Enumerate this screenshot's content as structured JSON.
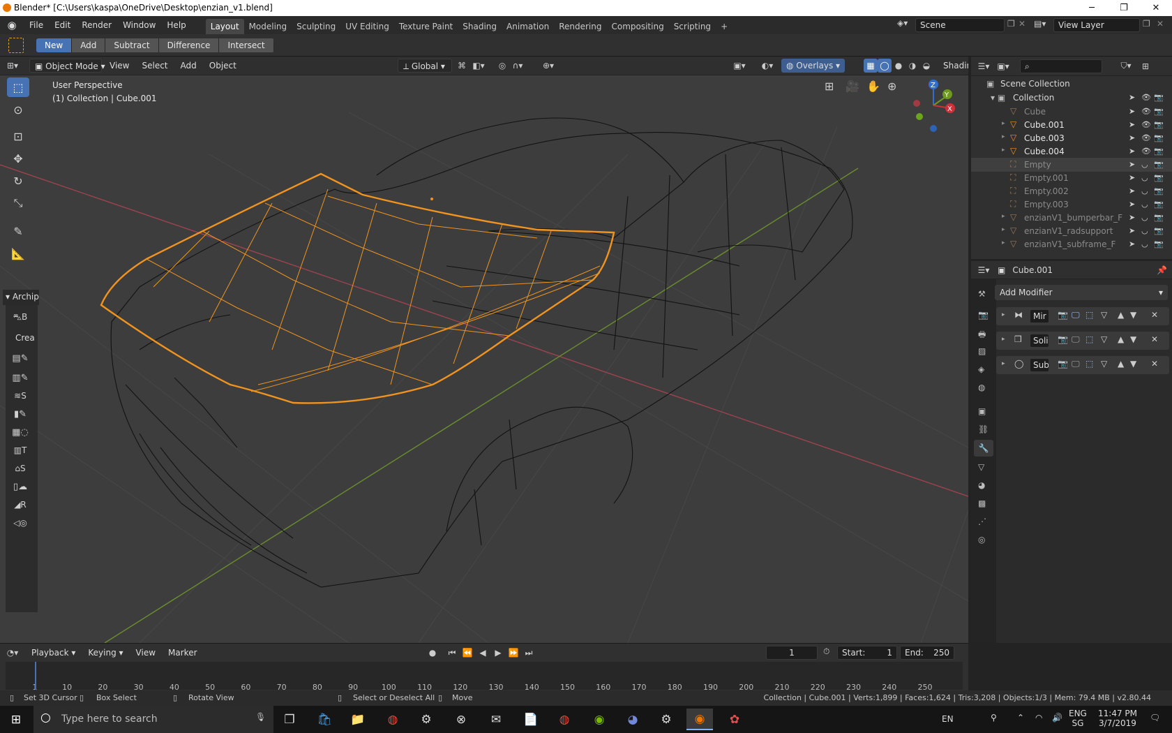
{
  "window": {
    "title": "Blender* [C:\\Users\\kaspa\\OneDrive\\Desktop\\enzian_v1.blend]",
    "minimize": "─",
    "restore": "❐",
    "close": "✕"
  },
  "menubar": {
    "items": [
      "File",
      "Edit",
      "Render",
      "Window",
      "Help"
    ],
    "workspaces": [
      "Layout",
      "Modeling",
      "Sculpting",
      "UV Editing",
      "Texture Paint",
      "Shading",
      "Animation",
      "Rendering",
      "Compositing",
      "Scripting"
    ],
    "add_workspace": "+",
    "scene": "Scene",
    "view_layer": "View Layer"
  },
  "bool_tools": {
    "new": "New",
    "add": "Add",
    "subtract": "Subtract",
    "difference": "Difference",
    "intersect": "Intersect"
  },
  "viewport": {
    "mode": "Object Mode",
    "menus": [
      "View",
      "Select",
      "Add",
      "Object"
    ],
    "orientation": "Global",
    "overlays": "Overlays",
    "shading": "Shading",
    "perspective": "User Perspective",
    "collection_info": "(1) Collection | Cube.001",
    "panel_archipack": "Archip",
    "panel_create": "Crea",
    "gizmo": {
      "x": "X",
      "y": "Y",
      "z": "Z"
    },
    "colors": {
      "bg": "#3d3d3d",
      "wire": "#121212",
      "selected": "#f0941f",
      "axis_x": "#9e4350",
      "axis_y": "#6a8e2e",
      "grid": "#474747"
    }
  },
  "outliner": {
    "root": "Scene Collection",
    "collection": "Collection",
    "items": [
      "Cube",
      "Cube.001",
      "Cube.003",
      "Cube.004",
      "Empty",
      "Empty.001",
      "Empty.002",
      "Empty.003",
      "enzianV1_bumperbar_F",
      "enzianV1_radsupport",
      "enzianV1_subframe_F"
    ]
  },
  "properties": {
    "object": "Cube.001",
    "add_modifier": "Add Modifier",
    "modifiers": [
      "Mir",
      "Soli",
      "Sub"
    ]
  },
  "timeline": {
    "menus": [
      "Playback",
      "Keying",
      "View",
      "Marker"
    ],
    "current_frame": "1",
    "start_label": "Start:",
    "start": "1",
    "end_label": "End:",
    "end": "250",
    "ticks": [
      "1",
      "10",
      "20",
      "30",
      "40",
      "50",
      "60",
      "70",
      "80",
      "90",
      "100",
      "110",
      "120",
      "130",
      "140",
      "150",
      "160",
      "170",
      "180",
      "190",
      "200",
      "210",
      "220",
      "230",
      "240",
      "250"
    ]
  },
  "statusbar": {
    "hints": [
      "Set 3D Cursor",
      "Box Select",
      "Rotate View",
      "Select or Deselect All",
      "Move"
    ],
    "stats": "Collection | Cube.001 | Verts:1,899 | Faces:1,624 | Tris:3,208 | Objects:1/3 | Mem: 79.4 MB | v2.80.44"
  },
  "taskbar": {
    "search": "Type here to search",
    "lang1": "EN",
    "lang2a": "ENG",
    "lang2b": "SG",
    "time": "11:47 PM",
    "date": "3/7/2019"
  }
}
